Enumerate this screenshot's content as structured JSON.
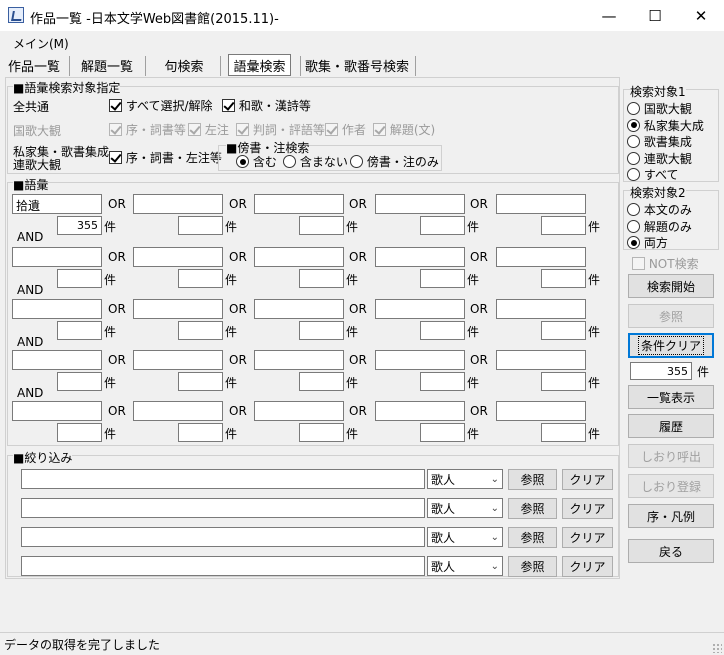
{
  "window": {
    "title": "作品一覧 -日本文学Web図書館(2015.11)-",
    "minimize": "—",
    "maximize": "☐",
    "close": "✕"
  },
  "menu": {
    "main": "メイン(M)"
  },
  "tabs": [
    "作品一覧",
    "解題一覧",
    "句検索",
    "語彙検索",
    "歌集・歌番号検索"
  ],
  "target_spec": {
    "title": "■語彙検索対象指定",
    "all_label": "全共通",
    "select_all": "すべて選択/解除",
    "waka_kanshi": "和歌・漢詩等",
    "kokka_label": "国歌大観",
    "kokka_opts": [
      "序・詞書等",
      "左注",
      "判詞・評語等",
      "作者",
      "解題(文)"
    ],
    "shika_label1": "私家集・歌書集成",
    "shika_label2": "連歌大観",
    "shika_opt": "序・詞書・左注等",
    "bosho_title": "■傍書・注検索",
    "bosho_opts": [
      "含む",
      "含まない",
      "傍書・注のみ"
    ]
  },
  "vocab": {
    "title": "■語彙",
    "or": "OR",
    "and": "AND",
    "ken": "件",
    "first_term": "拾遺",
    "first_count": "355"
  },
  "filter": {
    "title": "■絞り込み",
    "select_value": "歌人",
    "ref": "参照",
    "clear": "クリア"
  },
  "target1": {
    "title": "検索対象1",
    "options": [
      "国歌大観",
      "私家集大成",
      "歌書集成",
      "連歌大観",
      "すべて"
    ],
    "selected": 1
  },
  "target2": {
    "title": "検索対象2",
    "options": [
      "本文のみ",
      "解題のみ",
      "両方"
    ],
    "selected": 2
  },
  "side": {
    "not_search": "NOT検索",
    "search_start": "検索開始",
    "ref": "参照",
    "cond_clear": "条件クリア",
    "total_count": "355",
    "ken": "件",
    "list_view": "一覧表示",
    "history": "履歴",
    "bookmark_call": "しおり呼出",
    "bookmark_reg": "しおり登録",
    "preface": "序・凡例",
    "back": "戻る"
  },
  "status": {
    "text": "データの取得を完了しました"
  }
}
